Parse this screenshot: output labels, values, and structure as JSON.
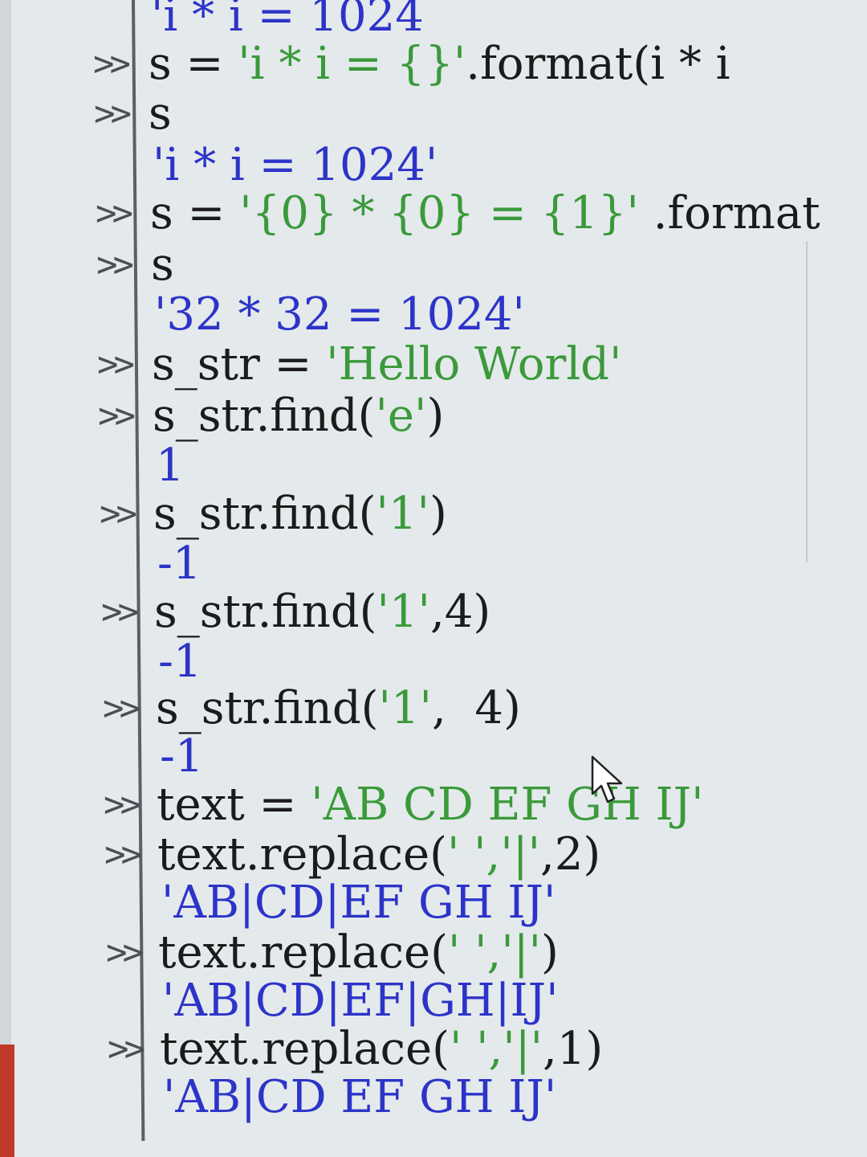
{
  "prompt_symbol": ">>",
  "lines": [
    {
      "kind": "output",
      "text": "'i * i = 1024"
    },
    {
      "kind": "input",
      "pre": "s = ",
      "str": "'i * i = {}'",
      "post": ".format(i * i"
    },
    {
      "kind": "input",
      "pre": "s",
      "str": "",
      "post": ""
    },
    {
      "kind": "output",
      "text": "'i * i = 1024'"
    },
    {
      "kind": "input",
      "pre": "s = ",
      "str": "'{0} * {0} = {1}'",
      "post": " .format"
    },
    {
      "kind": "input",
      "pre": "s",
      "str": "",
      "post": ""
    },
    {
      "kind": "output",
      "text": "'32 * 32 = 1024'"
    },
    {
      "kind": "input",
      "pre": "s_str = ",
      "str": "'Hello World'",
      "post": ""
    },
    {
      "kind": "input",
      "pre": "s_str.find(",
      "str": "'e'",
      "post": ")"
    },
    {
      "kind": "output",
      "text": "1"
    },
    {
      "kind": "input",
      "pre": "s_str.find(",
      "str": "'1'",
      "post": ")"
    },
    {
      "kind": "output",
      "text": "-1"
    },
    {
      "kind": "input",
      "pre": "s_str.find(",
      "str": "'1'",
      "post": ",4)"
    },
    {
      "kind": "output",
      "text": "-1"
    },
    {
      "kind": "input",
      "pre": "s_str.find(",
      "str": "'1'",
      "post": ",  4)"
    },
    {
      "kind": "output",
      "text": "-1"
    },
    {
      "kind": "input",
      "pre": "text = ",
      "str": "'AB CD EF GH IJ'",
      "post": ""
    },
    {
      "kind": "input",
      "pre": "text.replace(",
      "str": "' ','|'",
      "post": ",2)"
    },
    {
      "kind": "output",
      "text": "'AB|CD|EF GH IJ'"
    },
    {
      "kind": "input",
      "pre": "text.replace(",
      "str": "' ','|'",
      "post": ")"
    },
    {
      "kind": "output",
      "text": "'AB|CD|EF|GH|IJ'"
    },
    {
      "kind": "input",
      "pre": "text.replace(",
      "str": "' ','|'",
      "post": ",1)"
    },
    {
      "kind": "output",
      "text": "'AB|CD EF GH IJ'"
    }
  ],
  "colors": {
    "code": "#1b1b1b",
    "string": "#3a9a3a",
    "output": "#2c34c8",
    "background": "#e4e9ec"
  },
  "icons": {
    "cursor": "mouse-pointer-icon"
  }
}
